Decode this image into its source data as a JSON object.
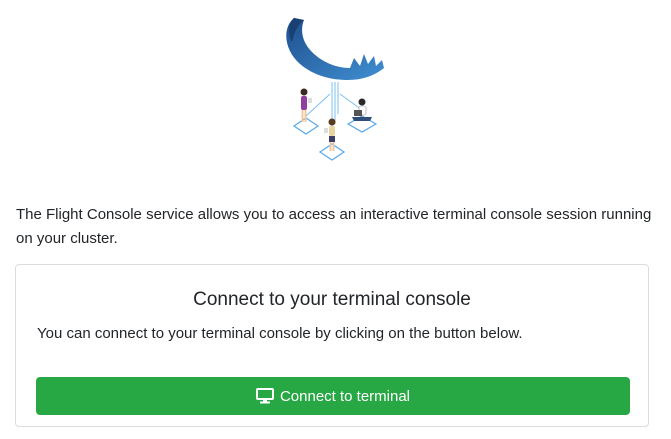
{
  "intro": {
    "text": "The Flight Console service allows you to access an interactive terminal console session running on your cluster."
  },
  "card": {
    "title": "Connect to your terminal console",
    "description": "You can connect to your terminal console by clicking on the button below.",
    "button_label": "Connect to terminal",
    "button_icon": "desktop-icon"
  },
  "colors": {
    "button": "#28a745",
    "antler_dark": "#1f4e8c",
    "antler_light": "#3f8fd2",
    "tile_outline": "#5aa9e6"
  }
}
